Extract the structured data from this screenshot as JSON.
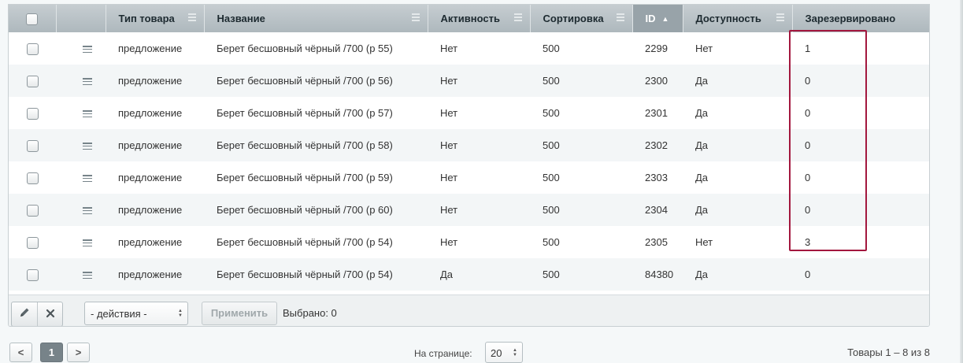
{
  "columns": {
    "type": "Тип товара",
    "name": "Название",
    "activity": "Активность",
    "sort": "Сортировка",
    "id": "ID",
    "availability": "Доступность",
    "reserved": "Зарезервировано",
    "sort_arrow": "▲"
  },
  "rows": [
    {
      "type": "предложение",
      "name": "Берет бесшовный чёрный /700 (р 55)",
      "activity": "Нет",
      "sort": "500",
      "id": "2299",
      "availability": "Нет",
      "reserved": "1"
    },
    {
      "type": "предложение",
      "name": "Берет бесшовный чёрный /700 (р 56)",
      "activity": "Нет",
      "sort": "500",
      "id": "2300",
      "availability": "Да",
      "reserved": "0"
    },
    {
      "type": "предложение",
      "name": "Берет бесшовный чёрный /700 (р 57)",
      "activity": "Нет",
      "sort": "500",
      "id": "2301",
      "availability": "Да",
      "reserved": "0"
    },
    {
      "type": "предложение",
      "name": "Берет бесшовный чёрный /700 (р 58)",
      "activity": "Нет",
      "sort": "500",
      "id": "2302",
      "availability": "Да",
      "reserved": "0"
    },
    {
      "type": "предложение",
      "name": "Берет бесшовный чёрный /700 (р 59)",
      "activity": "Нет",
      "sort": "500",
      "id": "2303",
      "availability": "Да",
      "reserved": "0"
    },
    {
      "type": "предложение",
      "name": "Берет бесшовный чёрный /700 (р 60)",
      "activity": "Нет",
      "sort": "500",
      "id": "2304",
      "availability": "Да",
      "reserved": "0"
    },
    {
      "type": "предложение",
      "name": "Берет бесшовный чёрный /700 (р 54)",
      "activity": "Нет",
      "sort": "500",
      "id": "2305",
      "availability": "Нет",
      "reserved": "3"
    },
    {
      "type": "предложение",
      "name": "Берет бесшовный чёрный /700 (р 54)",
      "activity": "Да",
      "sort": "500",
      "id": "84380",
      "availability": "Да",
      "reserved": "0"
    }
  ],
  "footer": {
    "edit_icon": "pencil-icon",
    "delete_icon": "close-icon",
    "action_select": "- действия -",
    "apply_label": "Применить",
    "selected_text": "Выбрано: 0"
  },
  "pagination": {
    "prev": "<",
    "current_page": "1",
    "next": ">",
    "per_page_label": "На странице:",
    "per_page_value": "20",
    "total_text": "Товары 1 – 8 из 8"
  },
  "colors": {
    "header_bg": "#aeb8bd",
    "sorted_header_bg": "#98a3a9",
    "highlight": "#a3173e",
    "row_alt": "#f3f6f7"
  }
}
